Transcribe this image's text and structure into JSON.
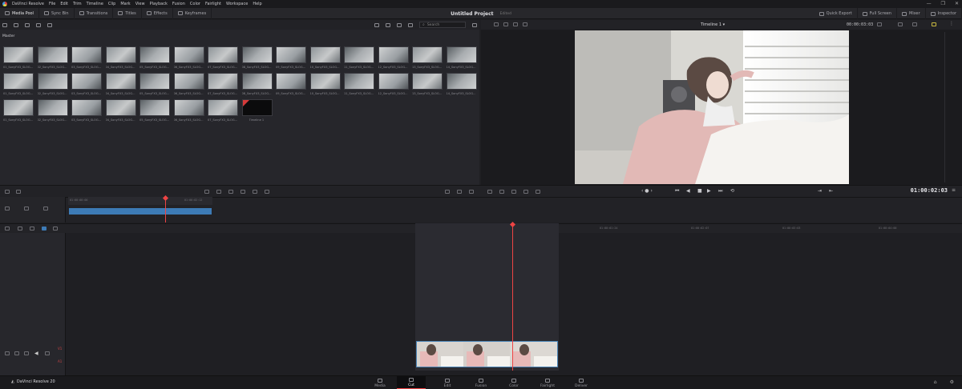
{
  "app": {
    "name": "DaVinci Resolve",
    "menu": [
      "DaVinci Resolve",
      "File",
      "Edit",
      "Trim",
      "Timeline",
      "Clip",
      "Mark",
      "View",
      "Playback",
      "Fusion",
      "Color",
      "Fairlight",
      "Workspace",
      "Help"
    ],
    "window_controls": [
      "—",
      "❐",
      "✕"
    ]
  },
  "toolbar": {
    "left": [
      {
        "label": "Media Pool",
        "icon": "media-pool-icon",
        "active": true
      },
      {
        "label": "Sync Bin",
        "icon": "sync-bin-icon"
      },
      {
        "label": "Transitions",
        "icon": "transitions-icon"
      },
      {
        "label": "Titles",
        "icon": "titles-icon"
      },
      {
        "label": "Effects",
        "icon": "effects-icon"
      },
      {
        "label": "Keyframes",
        "icon": "keyframes-icon"
      }
    ],
    "project_title": "Untitled Project",
    "project_status": "Edited",
    "right": [
      {
        "label": "Quick Export",
        "icon": "export-icon"
      },
      {
        "label": "Full Screen",
        "icon": "fullscreen-icon"
      },
      {
        "label": "Mixer",
        "icon": "mixer-icon"
      },
      {
        "label": "Inspector",
        "icon": "inspector-icon"
      }
    ]
  },
  "media_pool": {
    "search_placeholder": "Search",
    "bin_title": "Master",
    "clips": [
      "01_SonyFX3_SLOG...",
      "02_SonyFX3_SLOG...",
      "03_SonyFX3_SLOG...",
      "04_SonyFX3_SLOG...",
      "05_SonyFX3_SLOG...",
      "06_SonyFX3_SLOG...",
      "07_SonyFX3_SLOG...",
      "08_SonyFX3_SLOG...",
      "09_SonyFX3_SLOG...",
      "10_SonyFX3_SLOG...",
      "11_SonyFX3_SLOG...",
      "12_SonyFX3_SLOG...",
      "13_SonyFX3_SLOG...",
      "14_SonyFX3_SLOG...",
      "01_SonyFX3_SLOG...",
      "02_SonyFX3_SLOG...",
      "03_SonyFX3_SLOG...",
      "04_SonyFX3_SLOG...",
      "05_SonyFX3_SLOG...",
      "06_SonyFX3_SLOG...",
      "07_SonyFX3_SLOG...",
      "08_SonyFX3_SLOG...",
      "09_SonyFX3_SLOG...",
      "10_SonyFX3_SLOG...",
      "11_SonyFX3_SLOG...",
      "12_SonyFX3_SLOG...",
      "13_SonyFX3_SLOG...",
      "14_SonyFX3_SLOG...",
      "01_SonyFX3_SLOG...",
      "02_SonyFX3_SLOG...",
      "03_SonyFX3_SLOG...",
      "04_SonyFX3_SLOG...",
      "05_SonyFX3_SLOG...",
      "06_SonyFX3_SLOG...",
      "07_SonyFX3_SLOG..."
    ],
    "timeline_item": "Timeline 1"
  },
  "viewer": {
    "timeline_name": "Timeline 1",
    "duration": "00:00:03:03",
    "timecode": "01:00:02:03"
  },
  "upper_timeline": {
    "ruler": [
      "01:00:00:00",
      "01:00:02:12"
    ]
  },
  "lower_timeline": {
    "ruler": [
      "01:00:00:00",
      "01:00:01:01",
      "01:00:01:24",
      "01:00:02:07",
      "01:00:03:03",
      "01:00:04:00"
    ],
    "tracks": [
      "V1",
      "A1"
    ]
  },
  "page_bar": {
    "brand": "DaVinci Resolve 20",
    "pages": [
      {
        "label": "Media",
        "icon": "media-page-icon"
      },
      {
        "label": "Cut",
        "icon": "cut-page-icon",
        "active": true
      },
      {
        "label": "Edit",
        "icon": "edit-page-icon"
      },
      {
        "label": "Fusion",
        "icon": "fusion-page-icon"
      },
      {
        "label": "Color",
        "icon": "color-page-icon"
      },
      {
        "label": "Fairlight",
        "icon": "fairlight-page-icon"
      },
      {
        "label": "Deliver",
        "icon": "deliver-page-icon"
      }
    ]
  },
  "colors": {
    "accent": "#e44444",
    "clip_blue": "#3d7bb6"
  }
}
